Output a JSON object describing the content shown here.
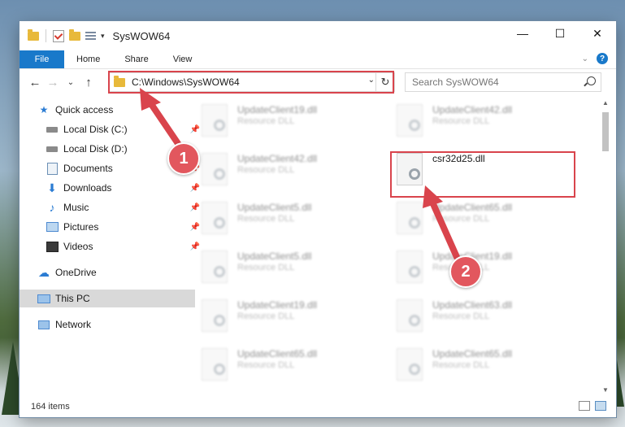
{
  "window": {
    "title": "SysWOW64"
  },
  "ribbon": {
    "tabs": [
      "File",
      "Home",
      "Share",
      "View"
    ]
  },
  "address": {
    "path": "C:\\Windows\\SysWOW64"
  },
  "search": {
    "placeholder": "Search SysWOW64"
  },
  "sidebar": {
    "items": [
      {
        "label": "Quick access",
        "icon": "star-icon"
      },
      {
        "label": "Local Disk (C:)",
        "icon": "drive-icon"
      },
      {
        "label": "Local Disk (D:)",
        "icon": "drive-icon"
      },
      {
        "label": "Documents",
        "icon": "documents-icon"
      },
      {
        "label": "Downloads",
        "icon": "downloads-icon"
      },
      {
        "label": "Music",
        "icon": "music-icon"
      },
      {
        "label": "Pictures",
        "icon": "pictures-icon"
      },
      {
        "label": "Videos",
        "icon": "videos-icon"
      },
      {
        "label": "OneDrive",
        "icon": "cloud-icon"
      },
      {
        "label": "This PC",
        "icon": "computer-icon",
        "selected": true
      },
      {
        "label": "Network",
        "icon": "network-icon"
      }
    ]
  },
  "files": [
    {
      "name": "UpdateClient19.dll",
      "type": "Resource DLL"
    },
    {
      "name": "UpdateClient42.dll",
      "type": "Resource DLL"
    },
    {
      "name": "UpdateClient42.dll",
      "type": "Resource DLL"
    },
    {
      "name": "csr32d25.dll",
      "type": ""
    },
    {
      "name": "UpdateClient5.dll",
      "type": "Resource DLL"
    },
    {
      "name": "UpdateClient65.dll",
      "type": "Resource DLL"
    },
    {
      "name": "UpdateClient5.dll",
      "type": "Resource DLL"
    },
    {
      "name": "UpdateClient19.dll",
      "type": "Resource DLL"
    },
    {
      "name": "UpdateClient19.dll",
      "type": "Resource DLL"
    },
    {
      "name": "UpdateClient63.dll",
      "type": "Resource DLL"
    },
    {
      "name": "UpdateClient65.dll",
      "type": "Resource DLL"
    },
    {
      "name": "UpdateClient65.dll",
      "type": "Resource DLL"
    }
  ],
  "status": {
    "item_count": "164 items"
  },
  "annotations": {
    "callout1": "1",
    "callout2": "2",
    "color": "#e2575e"
  }
}
